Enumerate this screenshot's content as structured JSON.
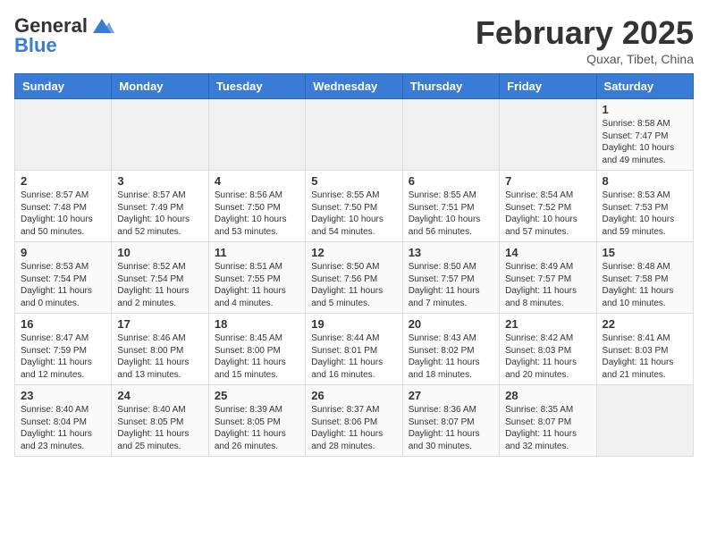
{
  "header": {
    "logo_general": "General",
    "logo_blue": "Blue",
    "month_title": "February 2025",
    "subtitle": "Quxar, Tibet, China"
  },
  "days_of_week": [
    "Sunday",
    "Monday",
    "Tuesday",
    "Wednesday",
    "Thursday",
    "Friday",
    "Saturday"
  ],
  "weeks": [
    {
      "days": [
        {
          "num": "",
          "info": ""
        },
        {
          "num": "",
          "info": ""
        },
        {
          "num": "",
          "info": ""
        },
        {
          "num": "",
          "info": ""
        },
        {
          "num": "",
          "info": ""
        },
        {
          "num": "",
          "info": ""
        },
        {
          "num": "1",
          "info": "Sunrise: 8:58 AM\nSunset: 7:47 PM\nDaylight: 10 hours and 49 minutes."
        }
      ]
    },
    {
      "days": [
        {
          "num": "2",
          "info": "Sunrise: 8:57 AM\nSunset: 7:48 PM\nDaylight: 10 hours and 50 minutes."
        },
        {
          "num": "3",
          "info": "Sunrise: 8:57 AM\nSunset: 7:49 PM\nDaylight: 10 hours and 52 minutes."
        },
        {
          "num": "4",
          "info": "Sunrise: 8:56 AM\nSunset: 7:50 PM\nDaylight: 10 hours and 53 minutes."
        },
        {
          "num": "5",
          "info": "Sunrise: 8:55 AM\nSunset: 7:50 PM\nDaylight: 10 hours and 54 minutes."
        },
        {
          "num": "6",
          "info": "Sunrise: 8:55 AM\nSunset: 7:51 PM\nDaylight: 10 hours and 56 minutes."
        },
        {
          "num": "7",
          "info": "Sunrise: 8:54 AM\nSunset: 7:52 PM\nDaylight: 10 hours and 57 minutes."
        },
        {
          "num": "8",
          "info": "Sunrise: 8:53 AM\nSunset: 7:53 PM\nDaylight: 10 hours and 59 minutes."
        }
      ]
    },
    {
      "days": [
        {
          "num": "9",
          "info": "Sunrise: 8:53 AM\nSunset: 7:54 PM\nDaylight: 11 hours and 0 minutes."
        },
        {
          "num": "10",
          "info": "Sunrise: 8:52 AM\nSunset: 7:54 PM\nDaylight: 11 hours and 2 minutes."
        },
        {
          "num": "11",
          "info": "Sunrise: 8:51 AM\nSunset: 7:55 PM\nDaylight: 11 hours and 4 minutes."
        },
        {
          "num": "12",
          "info": "Sunrise: 8:50 AM\nSunset: 7:56 PM\nDaylight: 11 hours and 5 minutes."
        },
        {
          "num": "13",
          "info": "Sunrise: 8:50 AM\nSunset: 7:57 PM\nDaylight: 11 hours and 7 minutes."
        },
        {
          "num": "14",
          "info": "Sunrise: 8:49 AM\nSunset: 7:57 PM\nDaylight: 11 hours and 8 minutes."
        },
        {
          "num": "15",
          "info": "Sunrise: 8:48 AM\nSunset: 7:58 PM\nDaylight: 11 hours and 10 minutes."
        }
      ]
    },
    {
      "days": [
        {
          "num": "16",
          "info": "Sunrise: 8:47 AM\nSunset: 7:59 PM\nDaylight: 11 hours and 12 minutes."
        },
        {
          "num": "17",
          "info": "Sunrise: 8:46 AM\nSunset: 8:00 PM\nDaylight: 11 hours and 13 minutes."
        },
        {
          "num": "18",
          "info": "Sunrise: 8:45 AM\nSunset: 8:00 PM\nDaylight: 11 hours and 15 minutes."
        },
        {
          "num": "19",
          "info": "Sunrise: 8:44 AM\nSunset: 8:01 PM\nDaylight: 11 hours and 16 minutes."
        },
        {
          "num": "20",
          "info": "Sunrise: 8:43 AM\nSunset: 8:02 PM\nDaylight: 11 hours and 18 minutes."
        },
        {
          "num": "21",
          "info": "Sunrise: 8:42 AM\nSunset: 8:03 PM\nDaylight: 11 hours and 20 minutes."
        },
        {
          "num": "22",
          "info": "Sunrise: 8:41 AM\nSunset: 8:03 PM\nDaylight: 11 hours and 21 minutes."
        }
      ]
    },
    {
      "days": [
        {
          "num": "23",
          "info": "Sunrise: 8:40 AM\nSunset: 8:04 PM\nDaylight: 11 hours and 23 minutes."
        },
        {
          "num": "24",
          "info": "Sunrise: 8:40 AM\nSunset: 8:05 PM\nDaylight: 11 hours and 25 minutes."
        },
        {
          "num": "25",
          "info": "Sunrise: 8:39 AM\nSunset: 8:05 PM\nDaylight: 11 hours and 26 minutes."
        },
        {
          "num": "26",
          "info": "Sunrise: 8:37 AM\nSunset: 8:06 PM\nDaylight: 11 hours and 28 minutes."
        },
        {
          "num": "27",
          "info": "Sunrise: 8:36 AM\nSunset: 8:07 PM\nDaylight: 11 hours and 30 minutes."
        },
        {
          "num": "28",
          "info": "Sunrise: 8:35 AM\nSunset: 8:07 PM\nDaylight: 11 hours and 32 minutes."
        },
        {
          "num": "",
          "info": ""
        }
      ]
    }
  ]
}
